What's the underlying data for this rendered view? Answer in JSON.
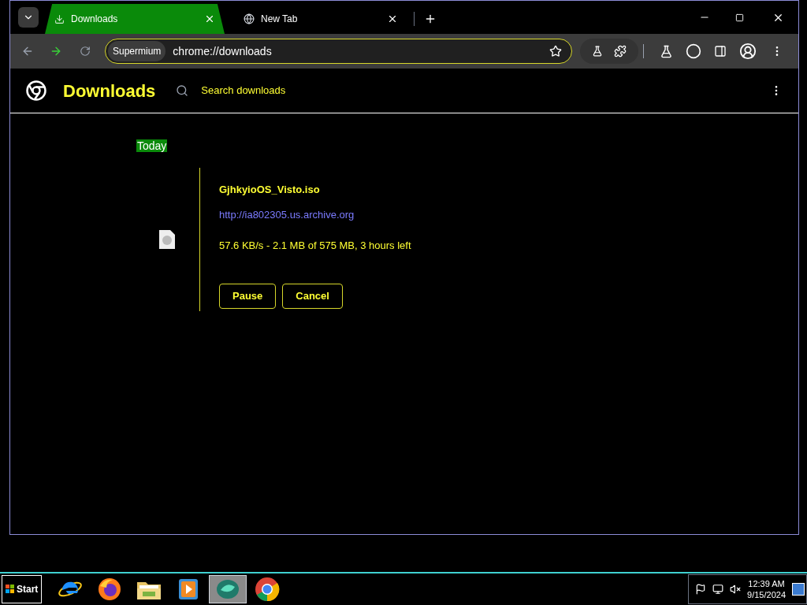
{
  "tabs": [
    {
      "label": "Downloads",
      "selected": true,
      "kind": "download"
    },
    {
      "label": "New Tab",
      "selected": false,
      "kind": "globe"
    }
  ],
  "toolbar": {
    "chip": "Supermium",
    "url": "chrome://downloads"
  },
  "header": {
    "title": "Downloads",
    "search_placeholder": "Search downloads"
  },
  "section": {
    "label": "Today"
  },
  "download": {
    "filename": "GjhkyioOS_Visto.iso",
    "source": "http://ia802305.us.archive.org",
    "status": "57.6 KB/s - 2.1 MB of 575 MB, 3 hours left",
    "buttons": [
      "Pause",
      "Cancel"
    ]
  },
  "taskbar": {
    "start": "Start",
    "apps": [
      {
        "kind": "ie",
        "selected": false
      },
      {
        "kind": "firefox",
        "selected": false
      },
      {
        "kind": "folder",
        "selected": false
      },
      {
        "kind": "media",
        "selected": false
      },
      {
        "kind": "fish",
        "selected": true
      },
      {
        "kind": "chrome",
        "selected": false
      }
    ],
    "time": "12:39 AM",
    "date": "9/15/2024"
  }
}
